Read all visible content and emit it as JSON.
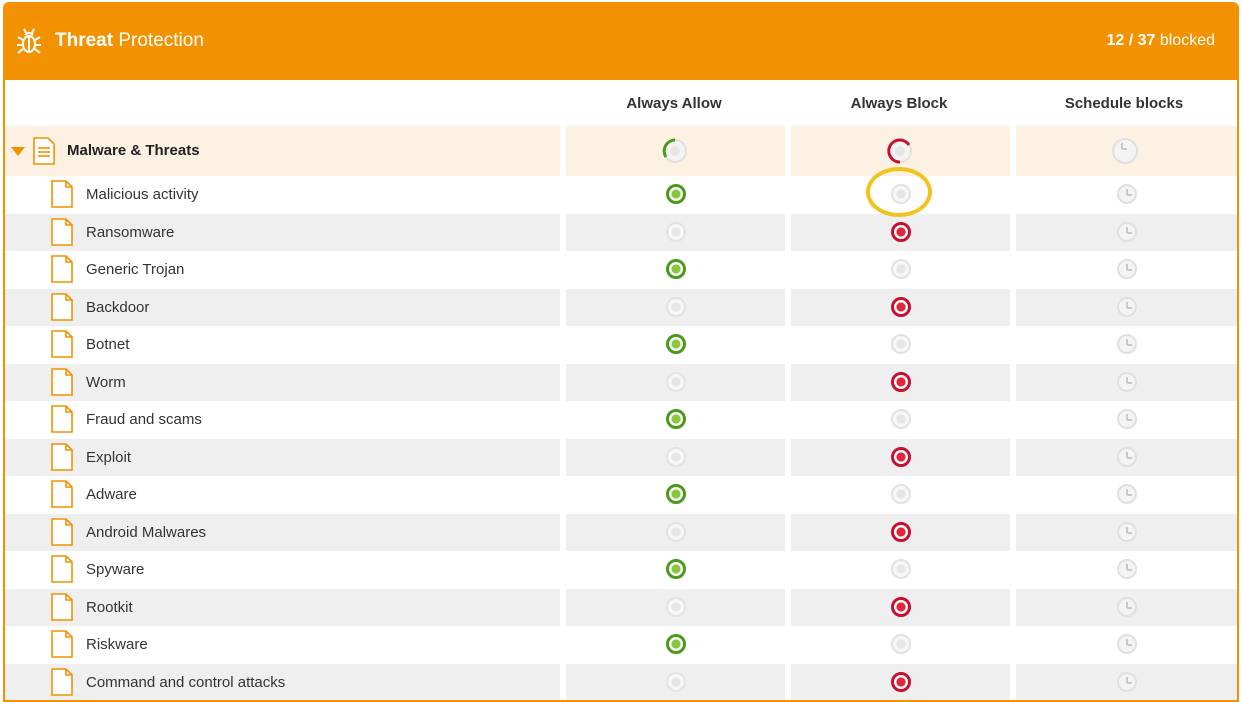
{
  "header": {
    "title_bold": "Threat",
    "title_rest": " Protection",
    "blocked_count": "12 / 37",
    "blocked_label": " blocked",
    "icon": "bug-icon",
    "accent_color": "#f39200"
  },
  "columns": {
    "allow": "Always Allow",
    "block": "Always Block",
    "schedule": "Schedule blocks"
  },
  "group": {
    "label": "Malware & Threats",
    "expanded": true
  },
  "rows": [
    {
      "label": "Malicious activity",
      "state": "allow"
    },
    {
      "label": "Ransomware",
      "state": "block"
    },
    {
      "label": "Generic Trojan",
      "state": "allow"
    },
    {
      "label": "Backdoor",
      "state": "block"
    },
    {
      "label": "Botnet",
      "state": "allow"
    },
    {
      "label": "Worm",
      "state": "block"
    },
    {
      "label": "Fraud and scams",
      "state": "allow"
    },
    {
      "label": "Exploit",
      "state": "block"
    },
    {
      "label": "Adware",
      "state": "allow"
    },
    {
      "label": "Android Malwares",
      "state": "block"
    },
    {
      "label": "Spyware",
      "state": "allow"
    },
    {
      "label": "Rootkit",
      "state": "block"
    },
    {
      "label": "Riskware",
      "state": "allow"
    },
    {
      "label": "Command and control attacks",
      "state": "block"
    }
  ]
}
